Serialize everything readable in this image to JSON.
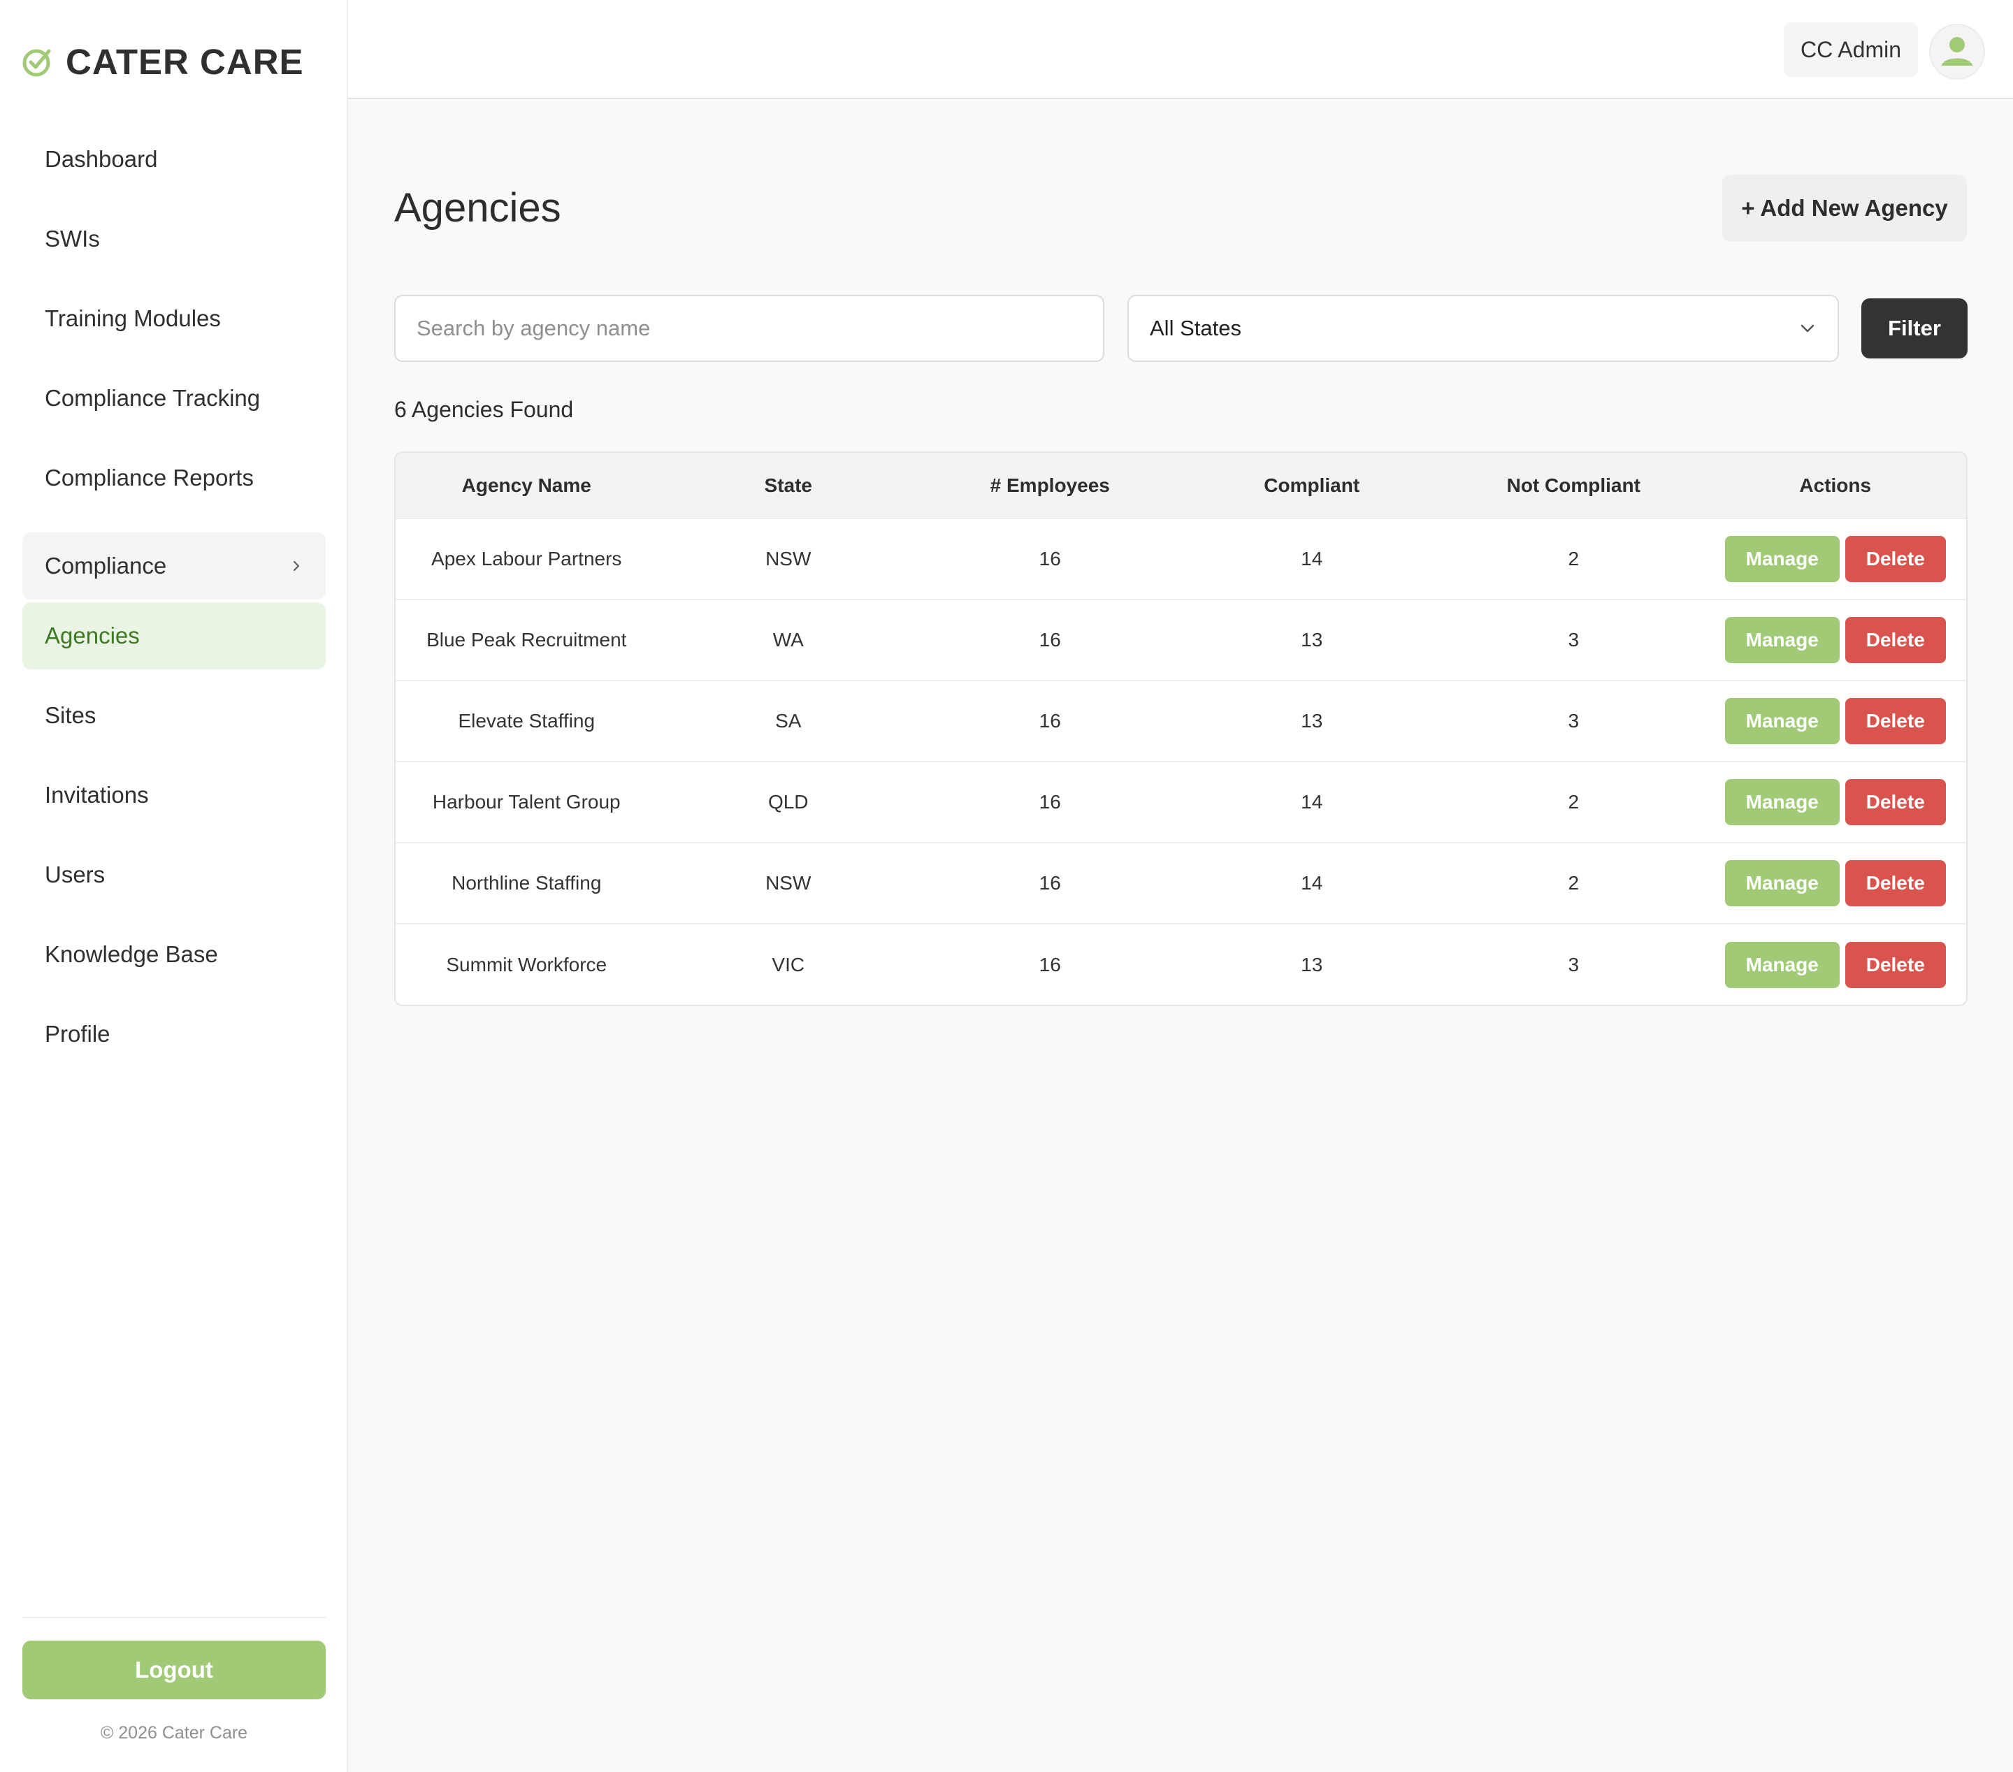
{
  "brand": {
    "name": "CATER CARE",
    "accent": "#a0ca76"
  },
  "sidebar": {
    "items": [
      {
        "label": "Dashboard",
        "name": "sidebar-item-dashboard"
      },
      {
        "label": "SWIs",
        "name": "sidebar-item-swis"
      },
      {
        "label": "Training Modules",
        "name": "sidebar-item-training-modules"
      },
      {
        "label": "Compliance Tracking",
        "name": "sidebar-item-compliance-tracking"
      },
      {
        "label": "Compliance Reports",
        "name": "sidebar-item-compliance-reports"
      }
    ],
    "group": {
      "label": "Compliance"
    },
    "sub_items": [
      {
        "label": "Agencies",
        "name": "sidebar-item-agencies",
        "active": true
      },
      {
        "label": "Sites",
        "name": "sidebar-item-sites"
      },
      {
        "label": "Invitations",
        "name": "sidebar-item-invitations"
      },
      {
        "label": "Users",
        "name": "sidebar-item-users"
      },
      {
        "label": "Knowledge Base",
        "name": "sidebar-item-knowledge-base"
      },
      {
        "label": "Profile",
        "name": "sidebar-item-profile"
      }
    ],
    "logout_label": "Logout",
    "copyright": "© 2026 Cater Care"
  },
  "header": {
    "user_name": "CC Admin",
    "avatar_icon": "user-avatar-icon"
  },
  "main": {
    "title": "Agencies",
    "add_button_label": "+ Add New Agency",
    "search": {
      "placeholder": "Search by agency name",
      "value": ""
    },
    "state_select": {
      "selected": "All States"
    },
    "filter_label": "Filter",
    "count_text": "6 Agencies Found"
  },
  "table": {
    "columns": [
      "Agency Name",
      "State",
      "# Employees",
      "Compliant",
      "Not Compliant",
      "Actions"
    ],
    "manage_label": "Manage",
    "delete_label": "Delete",
    "rows": [
      {
        "name": "Apex Labour Partners",
        "state": "NSW",
        "employees": "16",
        "compliant": "14",
        "not_compliant": "2"
      },
      {
        "name": "Blue Peak Recruitment",
        "state": "WA",
        "employees": "16",
        "compliant": "13",
        "not_compliant": "3"
      },
      {
        "name": "Elevate Staffing",
        "state": "SA",
        "employees": "16",
        "compliant": "13",
        "not_compliant": "3"
      },
      {
        "name": "Harbour Talent Group",
        "state": "QLD",
        "employees": "16",
        "compliant": "14",
        "not_compliant": "2"
      },
      {
        "name": "Northline Staffing",
        "state": "NSW",
        "employees": "16",
        "compliant": "14",
        "not_compliant": "2"
      },
      {
        "name": "Summit Workforce",
        "state": "VIC",
        "employees": "16",
        "compliant": "13",
        "not_compliant": "3"
      }
    ]
  },
  "colors": {
    "manage": "#a0ca76",
    "delete": "#d9534f",
    "filter": "#333333",
    "active_nav_bg": "#e9f4e4",
    "active_nav_text": "#3d7a23"
  }
}
